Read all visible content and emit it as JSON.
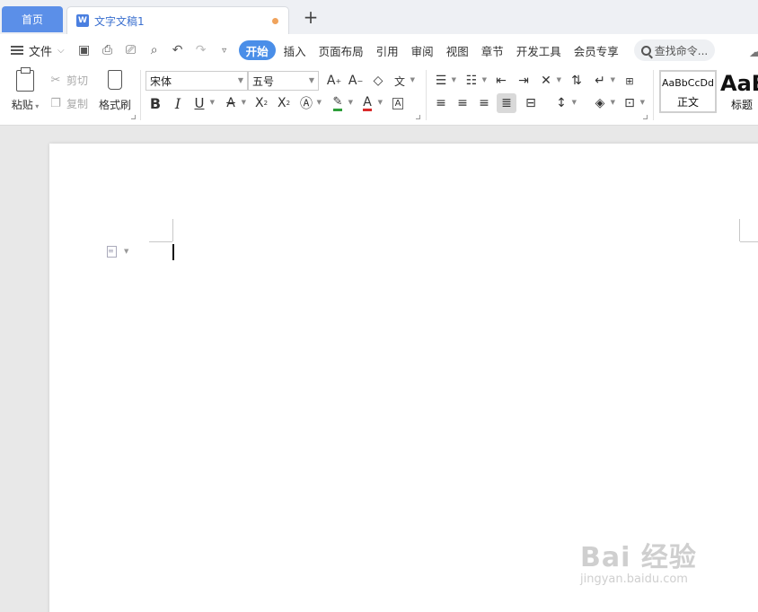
{
  "tabs": {
    "home_label": "首页",
    "doc_icon_letter": "W",
    "doc_title": "文字文稿1",
    "new_tab": "+"
  },
  "menu": {
    "file_label": "文件",
    "items": [
      "开始",
      "插入",
      "页面布局",
      "引用",
      "审阅",
      "视图",
      "章节",
      "开发工具",
      "会员专享"
    ],
    "search_placeholder": "查找命令..."
  },
  "clipboard": {
    "paste_label": "粘贴",
    "cut_label": "剪切",
    "copy_label": "复制",
    "format_brush_label": "格式刷"
  },
  "font": {
    "family": "宋体",
    "size": "五号"
  },
  "styles": {
    "normal_sample": "AaBbCcDd",
    "normal_label": "正文",
    "heading_sample": "AaB",
    "heading_label": "标题"
  },
  "watermark": {
    "brand": "Bai 经验",
    "url": "jingyan.baidu.com"
  },
  "colors": {
    "accent": "#4a8ee8",
    "home_tab": "#5b8fe8",
    "highlight": "#2e9e3a",
    "font_color": "#d92b2b"
  }
}
